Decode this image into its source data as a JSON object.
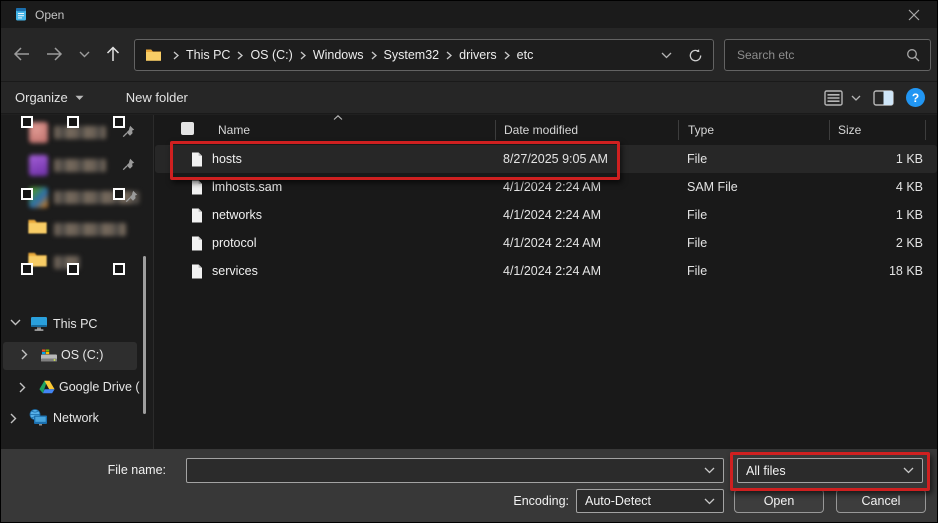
{
  "window": {
    "title": "Open"
  },
  "navbar": {
    "breadcrumb": [
      "This PC",
      "OS (C:)",
      "Windows",
      "System32",
      "drivers",
      "etc"
    ],
    "search_placeholder": "Search etc"
  },
  "toolbar": {
    "organize_label": "Organize",
    "new_folder_label": "New folder"
  },
  "sidebar": {
    "this_pc_label": "This PC",
    "os_c_label": "OS (C:)",
    "gdrive_label": "Google Drive (",
    "network_label": "Network"
  },
  "list": {
    "columns": {
      "name": "Name",
      "date": "Date modified",
      "type": "Type",
      "size": "Size"
    },
    "rows": [
      {
        "name": "hosts",
        "date": "8/27/2025 9:05 AM",
        "type": "File",
        "size": "1 KB"
      },
      {
        "name": "lmhosts.sam",
        "date": "4/1/2024 2:24 AM",
        "type": "SAM File",
        "size": "4 KB"
      },
      {
        "name": "networks",
        "date": "4/1/2024 2:24 AM",
        "type": "File",
        "size": "1 KB"
      },
      {
        "name": "protocol",
        "date": "4/1/2024 2:24 AM",
        "type": "File",
        "size": "2 KB"
      },
      {
        "name": "services",
        "date": "4/1/2024 2:24 AM",
        "type": "File",
        "size": "18 KB"
      }
    ]
  },
  "footer": {
    "file_name_label": "File name:",
    "file_name_value": "",
    "file_type_value": "All files",
    "encoding_label": "Encoding:",
    "encoding_value": "Auto-Detect",
    "open_label": "Open",
    "cancel_label": "Cancel"
  },
  "annotations": {
    "highlighted_row": "hosts",
    "highlighted_control": "All files"
  },
  "colors": {
    "annotation_red": "#cf2020",
    "help_blue": "#2196f3",
    "folder_yellow": "#f5c14e",
    "selection_bg": "#2e2e2e"
  }
}
